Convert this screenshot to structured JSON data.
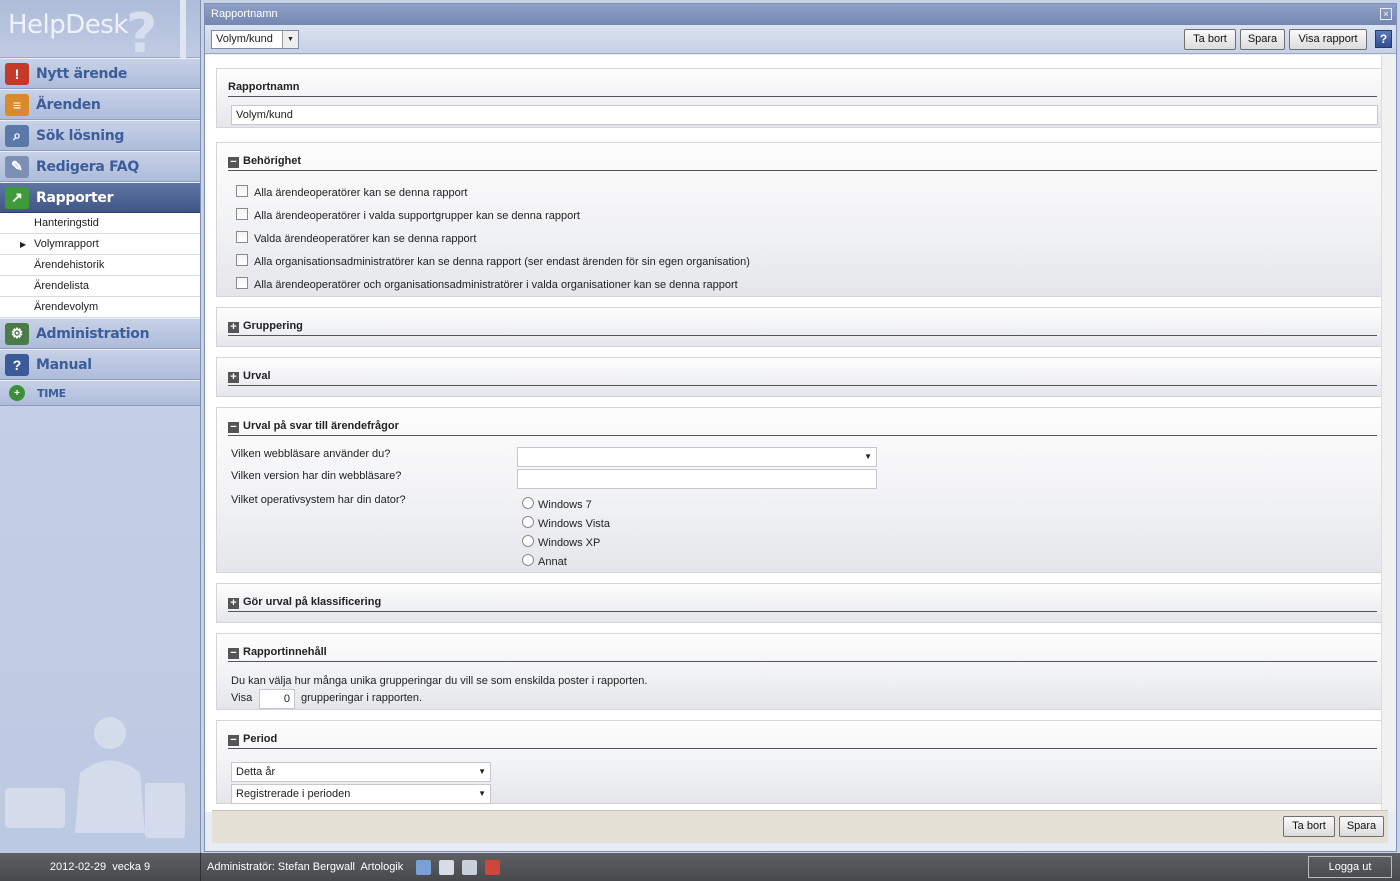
{
  "app": {
    "logo_text": "HelpDesk",
    "logo_mark": "?"
  },
  "sidebar": {
    "items": [
      {
        "label": "Nytt ärende",
        "icon": "new-case-icon"
      },
      {
        "label": "Ärenden",
        "icon": "cases-icon"
      },
      {
        "label": "Sök lösning",
        "icon": "search-solution-icon"
      },
      {
        "label": "Redigera FAQ",
        "icon": "edit-faq-icon"
      },
      {
        "label": "Rapporter",
        "icon": "reports-icon",
        "active": true
      }
    ],
    "subitems": [
      {
        "label": "Hanteringstid"
      },
      {
        "label": "Volymrapport",
        "current": true
      },
      {
        "label": "Ärendehistorik"
      },
      {
        "label": "Ärendelista"
      },
      {
        "label": "Ärendevolym"
      }
    ],
    "items_after": [
      {
        "label": "Administration",
        "icon": "administration-icon"
      },
      {
        "label": "Manual",
        "icon": "manual-icon"
      },
      {
        "label": "TIME",
        "icon": "time-icon"
      }
    ]
  },
  "window": {
    "title": "Rapportnamn",
    "close_glyph": "×"
  },
  "toolbar": {
    "report_select": "Volym/kund",
    "delete_label": "Ta bort",
    "save_label": "Spara",
    "show_label": "Visa rapport",
    "help_label": "?"
  },
  "form": {
    "name_section": {
      "title": "Rapportnamn",
      "value": "Volym/kund"
    },
    "permission_section": {
      "title": "Behörighet",
      "options": [
        "Alla ärendeoperatörer kan se denna rapport",
        "Alla ärendeoperatörer i valda supportgrupper kan se denna rapport",
        "Valda ärendeoperatörer kan se denna rapport",
        "Alla organisationsadministratörer kan se denna rapport (ser endast ärenden för sin egen organisation)",
        "Alla ärendeoperatörer och organisationsadministratörer i valda organisationer kan se denna rapport"
      ]
    },
    "grouping_section": {
      "title": "Gruppering"
    },
    "selection_section": {
      "title": "Urval"
    },
    "question_section": {
      "title": "Urval på svar till ärendefrågor",
      "q1": "Vilken webbläsare använder du?",
      "q1_value": "",
      "q2": "Vilken version har din webbläsare?",
      "q2_value": "",
      "q3": "Vilket operativsystem har din dator?",
      "q3_options": [
        "Windows 7",
        "Windows Vista",
        "Windows XP",
        "Annat"
      ]
    },
    "classification_section": {
      "title": "Gör urval på klassificering"
    },
    "content_section": {
      "title": "Rapportinnehåll",
      "description": "Du kan välja hur många unika grupperingar du vill se som enskilda poster i rapporten.",
      "show_label": "Visa",
      "show_value": "0",
      "show_suffix": "grupperingar i rapporten."
    },
    "period_section": {
      "title": "Period",
      "period_value": "Detta år",
      "type_value": "Registrerade i perioden"
    }
  },
  "bottom": {
    "delete_label": "Ta bort",
    "save_label": "Spara"
  },
  "statusbar": {
    "date": "2012-02-29  vecka 9",
    "user": "Administratör: Stefan Bergwall  Artologik",
    "logout_label": "Logga ut"
  }
}
